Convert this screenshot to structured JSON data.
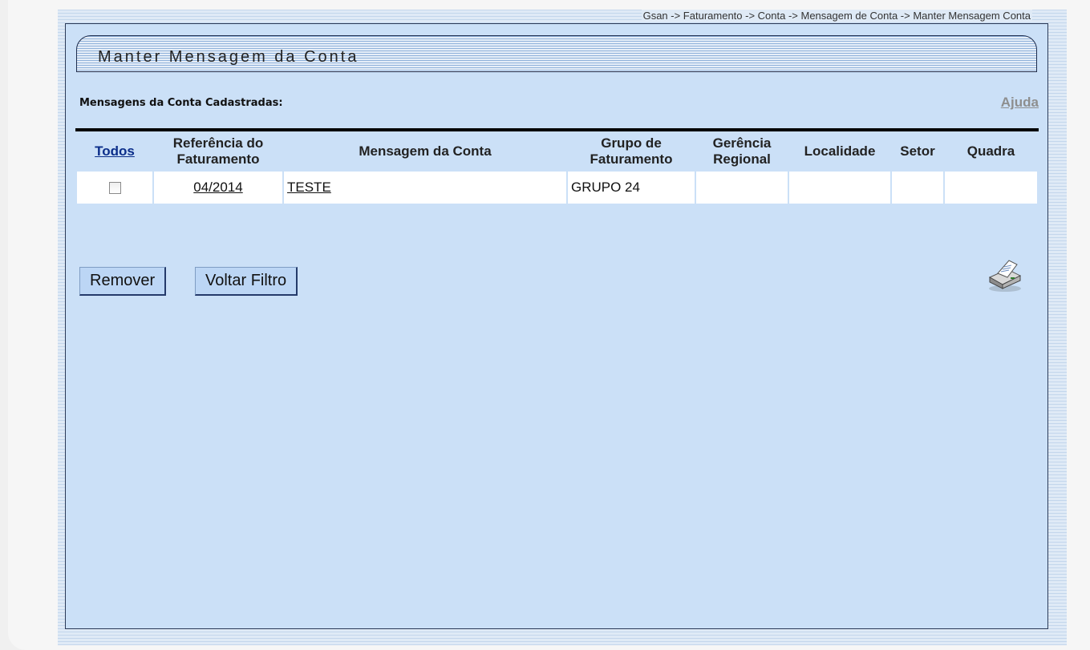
{
  "breadcrumb": "Gsan -> Faturamento -> Conta -> Mensagem de Conta -> Manter Mensagem Conta",
  "panel": {
    "title": "Manter Mensagem da Conta",
    "section_label": "Mensagens da Conta Cadastradas:",
    "help_link": "Ajuda"
  },
  "table": {
    "headers": {
      "todos": "Todos",
      "referencia": "Referência do Faturamento",
      "mensagem": "Mensagem da Conta",
      "grupo": "Grupo de Faturamento",
      "gerencia": "Gerência Regional",
      "localidade": "Localidade",
      "setor": "Setor",
      "quadra": "Quadra"
    },
    "rows": [
      {
        "checked": false,
        "referencia": "04/2014",
        "mensagem": "TESTE",
        "grupo": "GRUPO 24",
        "gerencia": "",
        "localidade": "",
        "setor": "",
        "quadra": ""
      }
    ]
  },
  "buttons": {
    "remover": "Remover",
    "voltar_filtro": "Voltar Filtro"
  },
  "icons": {
    "print": "printer-icon"
  },
  "colors": {
    "panel_bg": "#cbe0f7",
    "link_blue": "#0b2e8a",
    "button_bg": "#bcd6f5"
  }
}
